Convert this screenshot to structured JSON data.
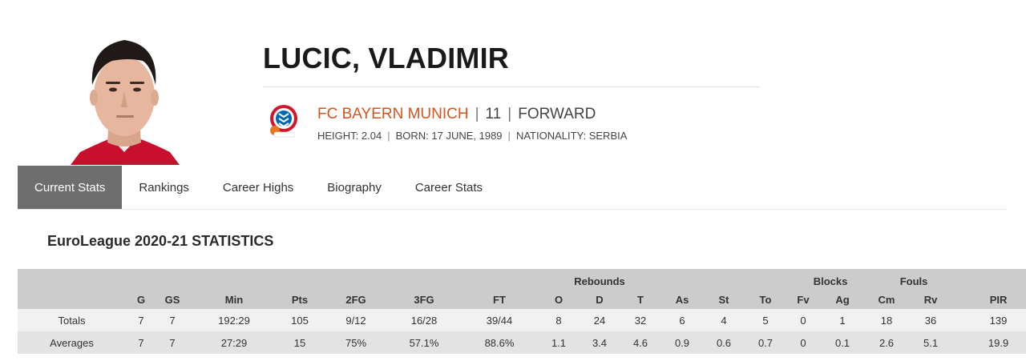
{
  "player": {
    "name": "LUCIC, VLADIMIR",
    "club": "FC BAYERN MUNICH",
    "number": "11",
    "position": "FORWARD",
    "height": "HEIGHT: 2.04",
    "born": "BORN: 17 JUNE, 1989",
    "nationality": "NATIONALITY: SERBIA"
  },
  "tabs": [
    "Current Stats",
    "Rankings",
    "Career Highs",
    "Biography",
    "Career Stats"
  ],
  "active_tab": "Current Stats",
  "section_title": "EuroLeague 2020-21 STATISTICS",
  "stats": {
    "groups": {
      "rebounds": "Rebounds",
      "blocks": "Blocks",
      "fouls": "Fouls"
    },
    "columns": [
      "",
      "G",
      "GS",
      "Min",
      "Pts",
      "2FG",
      "3FG",
      "FT",
      "O",
      "D",
      "T",
      "As",
      "St",
      "To",
      "Fv",
      "Ag",
      "Cm",
      "Rv",
      "PIR"
    ],
    "rows": [
      [
        "Totals",
        "7",
        "7",
        "192:29",
        "105",
        "9/12",
        "16/28",
        "39/44",
        "8",
        "24",
        "32",
        "6",
        "4",
        "5",
        "0",
        "1",
        "18",
        "36",
        "139"
      ],
      [
        "Averages",
        "7",
        "7",
        "27:29",
        "15",
        "75%",
        "57.1%",
        "88.6%",
        "1.1",
        "3.4",
        "4.6",
        "0.9",
        "0.6",
        "0.7",
        "0",
        "0.1",
        "2.6",
        "5.1",
        "19.9"
      ]
    ]
  },
  "colors": {
    "club_accent": "#d2541e",
    "active_tab_bg": "#6e6e6e",
    "table_header_bg": "#cccccc",
    "row_light": "#f1f1f1",
    "row_dark": "#e3e3e3"
  },
  "icons": {
    "club_logo": "fc-bayern-munich-basketball-logo",
    "photo": "player-headshot"
  }
}
